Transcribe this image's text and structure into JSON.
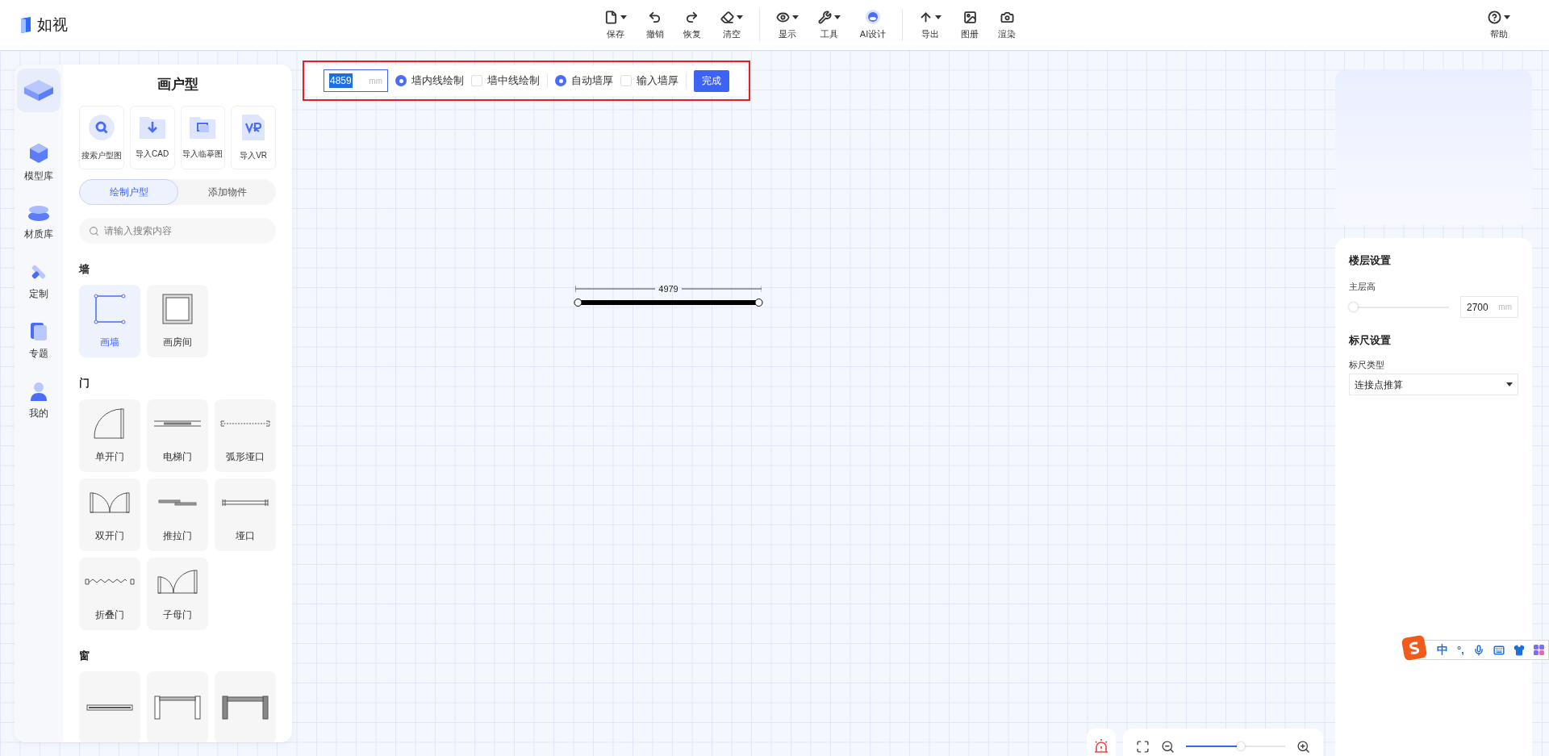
{
  "app": {
    "logo_text": "如视"
  },
  "toolbar": {
    "groups": [
      [
        {
          "label": "保存",
          "kind": "save",
          "dropdown": true
        },
        {
          "label": "撤销",
          "kind": "undo",
          "dropdown": false
        },
        {
          "label": "恢复",
          "kind": "redo",
          "dropdown": false
        },
        {
          "label": "清空",
          "kind": "clear",
          "dropdown": true
        }
      ],
      [
        {
          "label": "显示",
          "kind": "view",
          "dropdown": true
        },
        {
          "label": "工具",
          "kind": "tools",
          "dropdown": true
        },
        {
          "label": "AI设计",
          "kind": "ai",
          "dropdown": false
        }
      ],
      [
        {
          "label": "导出",
          "kind": "export",
          "dropdown": true
        },
        {
          "label": "图册",
          "kind": "album",
          "dropdown": false
        },
        {
          "label": "渲染",
          "kind": "render",
          "dropdown": false
        }
      ]
    ],
    "help": {
      "label": "帮助",
      "kind": "help",
      "dropdown": true
    }
  },
  "side_nav": [
    {
      "label": "模型库",
      "kind": "models"
    },
    {
      "label": "材质库",
      "kind": "materials"
    },
    {
      "label": "定制",
      "kind": "custom"
    },
    {
      "label": "专题",
      "kind": "topics"
    },
    {
      "label": "我的",
      "kind": "mine"
    }
  ],
  "panel": {
    "title": "画户型",
    "imports": [
      {
        "label": "搜索户型图",
        "kind": "search"
      },
      {
        "label": "导入CAD",
        "kind": "cad"
      },
      {
        "label": "导入临摹图",
        "kind": "trace"
      },
      {
        "label": "导入VR",
        "kind": "vr"
      }
    ],
    "tabs": [
      {
        "label": "绘制户型",
        "selected": true
      },
      {
        "label": "添加物件",
        "selected": false
      }
    ],
    "search": {
      "placeholder": "请输入搜索内容"
    },
    "sections": [
      {
        "title": "墙",
        "items": [
          {
            "label": "画墙",
            "kind": "draw_wall",
            "selected": true
          },
          {
            "label": "画房间",
            "kind": "draw_room",
            "selected": false
          }
        ]
      },
      {
        "title": "门",
        "items": [
          {
            "label": "单开门",
            "kind": "single_door",
            "selected": false
          },
          {
            "label": "电梯门",
            "kind": "elevator_door",
            "selected": false
          },
          {
            "label": "弧形垭口",
            "kind": "arc_opening",
            "selected": false
          },
          {
            "label": "双开门",
            "kind": "double_door",
            "selected": false
          },
          {
            "label": "推拉门",
            "kind": "sliding_door",
            "selected": false
          },
          {
            "label": "垭口",
            "kind": "opening",
            "selected": false
          },
          {
            "label": "折叠门",
            "kind": "folding_door",
            "selected": false
          },
          {
            "label": "子母门",
            "kind": "unequal_door",
            "selected": false
          }
        ]
      },
      {
        "title": "窗",
        "items": [
          {
            "kind": "flat_window",
            "selected": false
          },
          {
            "kind": "bay_window",
            "selected": false
          },
          {
            "kind": "corner_window",
            "selected": false
          }
        ]
      }
    ]
  },
  "draw_toolbar": {
    "length": {
      "value": "4859",
      "unit": "mm"
    },
    "line_modes": [
      {
        "label": "墙内线绘制",
        "selected": true
      },
      {
        "label": "墙中线绘制",
        "selected": false
      }
    ],
    "thickness_modes": [
      {
        "label": "自动墙厚",
        "selected": true
      },
      {
        "label": "输入墙厚",
        "selected": false
      }
    ],
    "done_button": "完成"
  },
  "canvas": {
    "wall": {
      "dimension": "4979"
    }
  },
  "settings": {
    "floor": {
      "title": "楼层设置",
      "height_label": "主层高",
      "level": 0,
      "value": "2700",
      "unit": "mm"
    },
    "ruler": {
      "title": "标尺设置",
      "type_label": "标尺类型",
      "type_value": "连接点推算"
    }
  },
  "zoom": {
    "level": 0.55
  },
  "ime": {
    "mode": "中",
    "punctuation": "°,"
  }
}
